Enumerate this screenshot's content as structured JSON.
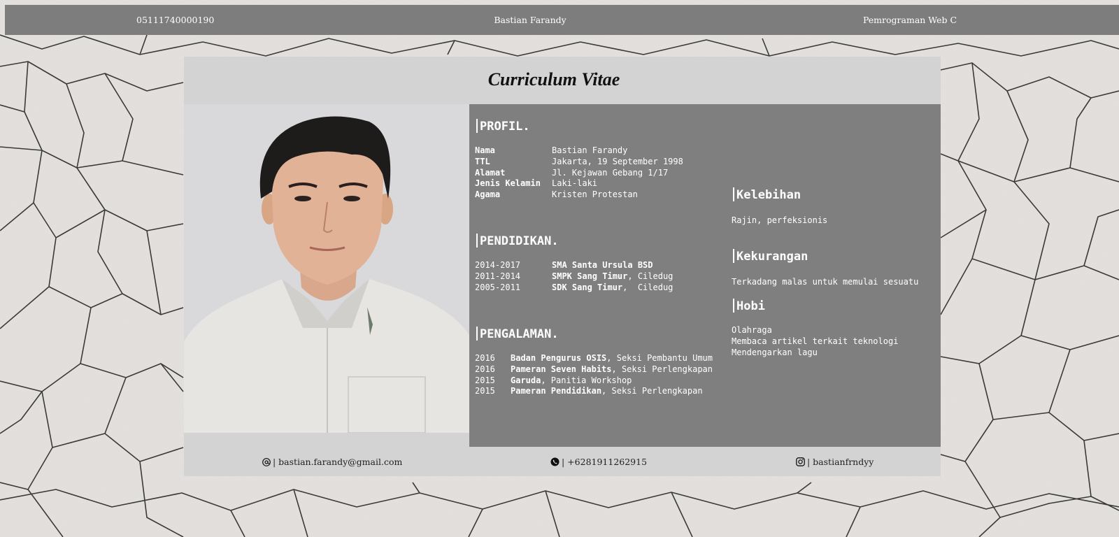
{
  "topbar": {
    "nim": "05111740000190",
    "name": "Bastian Farandy",
    "course": "Pemrograman Web C"
  },
  "card": {
    "title": "Curriculum Vitae"
  },
  "profil": {
    "title": "PROFIL.",
    "rows": [
      {
        "key": "Nama",
        "value": "Bastian Farandy"
      },
      {
        "key": "TTL",
        "value": "Jakarta, 19 September 1998"
      },
      {
        "key": "Alamat",
        "value": "Jl. Kejawan Gebang 1/17"
      },
      {
        "key": "Jenis Kelamin",
        "value": "Laki-laki"
      },
      {
        "key": "Agama",
        "value": "Kristen Protestan"
      }
    ]
  },
  "pendidikan": {
    "title": "PENDIDIKAN.",
    "rows": [
      {
        "year": "2014-2017",
        "school": "SMA Santa Ursula BSD",
        "place": ""
      },
      {
        "year": "2011-2014",
        "school": "SMPK Sang Timur",
        "place": ", Ciledug"
      },
      {
        "year": "2005-2011",
        "school": "SDK Sang Timur",
        "place": ",  Ciledug"
      }
    ]
  },
  "pengalaman": {
    "title": "PENGALAMAN.",
    "rows": [
      {
        "year": "2016",
        "org": "Badan Pengurus OSIS",
        "role": ", Seksi Pembantu Umum"
      },
      {
        "year": "2016",
        "org": "Pameran Seven Habits",
        "role": ", Seksi Perlengkapan"
      },
      {
        "year": "2015",
        "org": "Garuda",
        "role": ", Panitia Workshop"
      },
      {
        "year": "2015",
        "org": "Pameran Pendidikan",
        "role": ", Seksi Perlengkapan"
      }
    ]
  },
  "kelebihan": {
    "title": "Kelebihan",
    "text": "Rajin, perfeksionis"
  },
  "kekurangan": {
    "title": "Kekurangan",
    "text": "Terkadang malas untuk memulai sesuatu"
  },
  "hobi": {
    "title": "Hobi",
    "items": [
      "Olahraga",
      "Membaca artikel terkait teknologi",
      "Mendengarkan lagu"
    ]
  },
  "footer": {
    "email": "| bastian.farandy@gmail.com",
    "phone": "| +6281911262915",
    "instagram": "| bastianfrndyy",
    "icons": {
      "email": "email-icon",
      "phone": "whatsapp-icon",
      "instagram": "instagram-icon"
    }
  },
  "colors": {
    "topbar": "#7d7d7d",
    "card": "#d3d3d3",
    "panel": "#7f7f7f",
    "text_light": "#ffffff"
  }
}
